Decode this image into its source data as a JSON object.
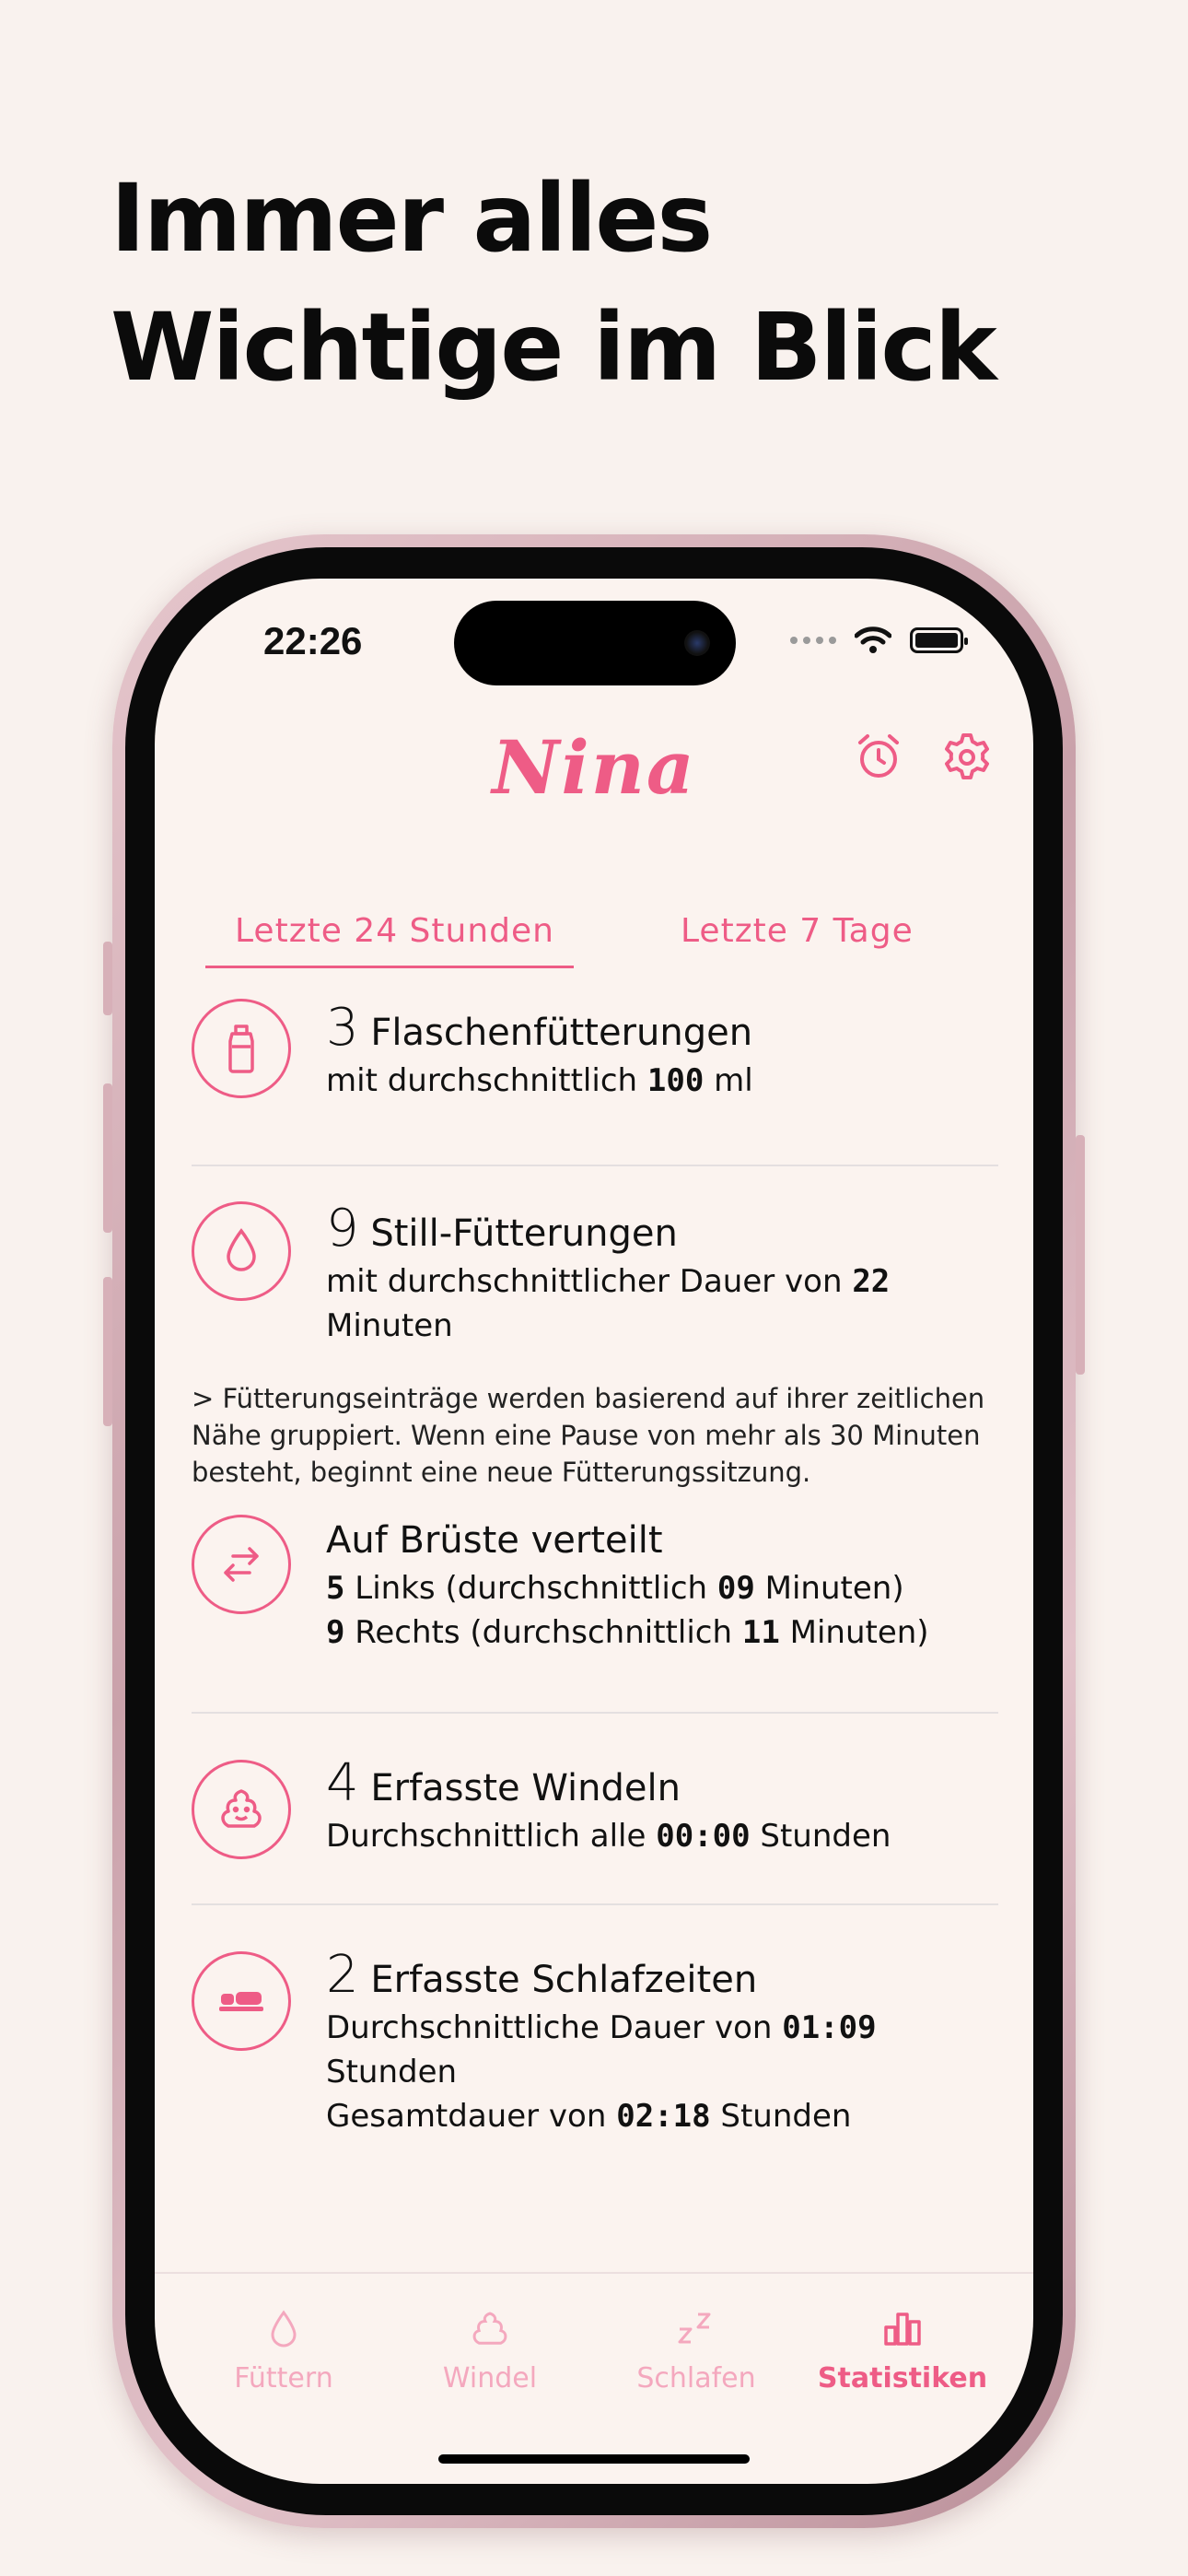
{
  "headline": {
    "line1": "Immer alles",
    "line2": "Wichtige im Blick"
  },
  "status_bar": {
    "time": "22:26"
  },
  "app": {
    "title": "Nina",
    "accent": "#ee5c86",
    "icons": [
      "alarm-icon",
      "gear-icon"
    ]
  },
  "tabs": [
    {
      "label": "Letzte 24 Stunden",
      "selected": true
    },
    {
      "label": "Letzte 7 Tage",
      "selected": false
    }
  ],
  "stats": {
    "bottle": {
      "count": "3",
      "title": "Flaschenfütterungen",
      "prefix": "mit durchschnittlich",
      "value": "100",
      "unit": "ml"
    },
    "breast": {
      "count": "9",
      "title": "Still-Fütterungen",
      "prefix": "mit durchschnittlicher Dauer von",
      "value": "22",
      "unit": "Minuten"
    },
    "note": "> Fütterungseinträge werden basierend auf ihrer zeitlichen Nähe gruppiert. Wenn eine Pause von mehr als 30 Minuten besteht, beginnt eine neue Fütterungssitzung.",
    "sides": {
      "title": "Auf Brüste verteilt",
      "left_count": "5",
      "left_text": "Links (durchschnittlich",
      "left_value": "09",
      "left_unit": "Minuten)",
      "right_count": "9",
      "right_text": "Rechts (durchschnittlich",
      "right_value": "11",
      "right_unit": "Minuten)"
    },
    "diapers": {
      "count": "4",
      "title": "Erfasste Windeln",
      "prefix": "Durchschnittlich alle",
      "value": "00:00",
      "unit": "Stunden"
    },
    "sleep": {
      "count": "2",
      "title": "Erfasste Schlafzeiten",
      "avg_prefix": "Durchschnittliche Dauer von",
      "avg_value": "01:09",
      "avg_unit": "Stunden",
      "total_prefix": "Gesamtdauer von",
      "total_value": "02:18",
      "total_unit": "Stunden"
    }
  },
  "tabbar": [
    {
      "label": "Füttern",
      "icon": "drop-icon"
    },
    {
      "label": "Windel",
      "icon": "poop-icon"
    },
    {
      "label": "Schlafen",
      "icon": "zz-icon"
    },
    {
      "label": "Statistiken",
      "icon": "bar-chart-icon",
      "active": true
    }
  ]
}
